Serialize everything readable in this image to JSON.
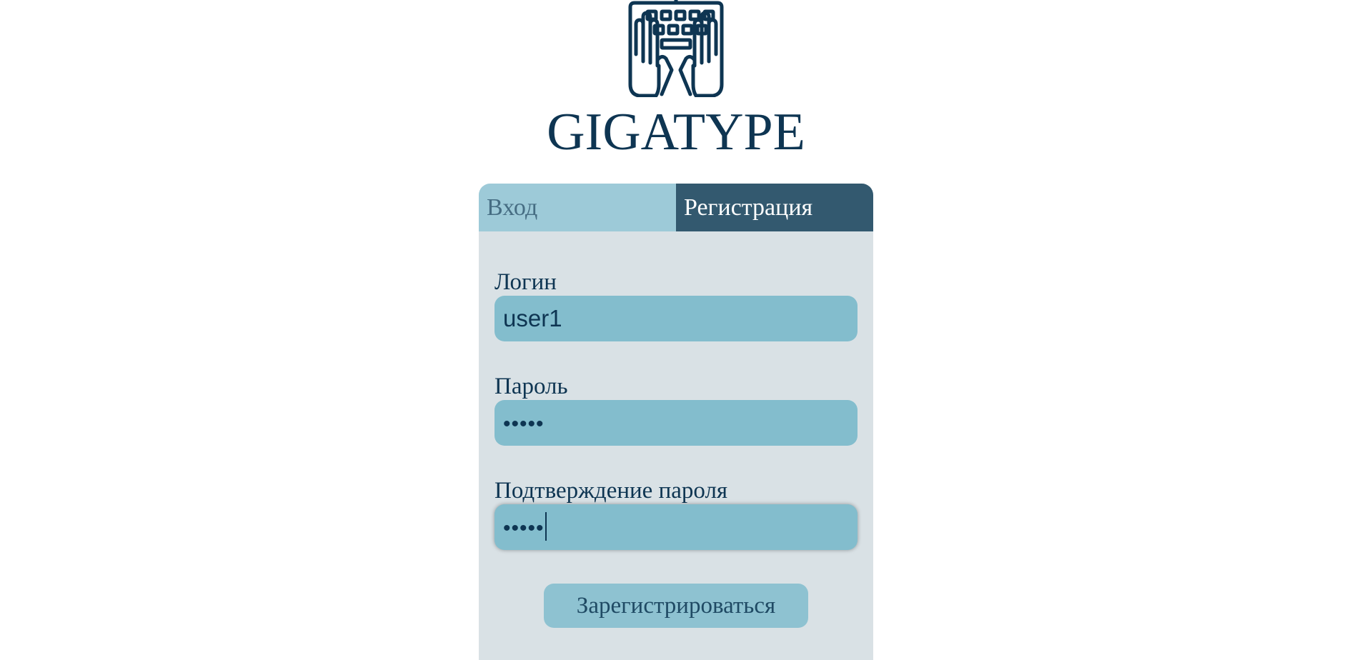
{
  "brand": {
    "name": "GIGATYPE",
    "color": "#0e3552"
  },
  "tabs": {
    "login_label": "Вход",
    "register_label": "Регистрация",
    "active": "register"
  },
  "form": {
    "login_label": "Логин",
    "login_value": "user1",
    "password_label": "Пароль",
    "password_value": "•••••",
    "confirm_label": "Подтверждение пароля",
    "confirm_value": "•••••",
    "submit_label": "Зарегистрироваться"
  },
  "colors": {
    "card_bg": "#d9e1e5",
    "tab_inactive": "#9dcad8",
    "tab_active": "#33596f",
    "input_bg": "#83bdcd",
    "button_bg": "#8ec2d1"
  },
  "icons": {
    "logo": "hands-on-keyboard-icon"
  }
}
